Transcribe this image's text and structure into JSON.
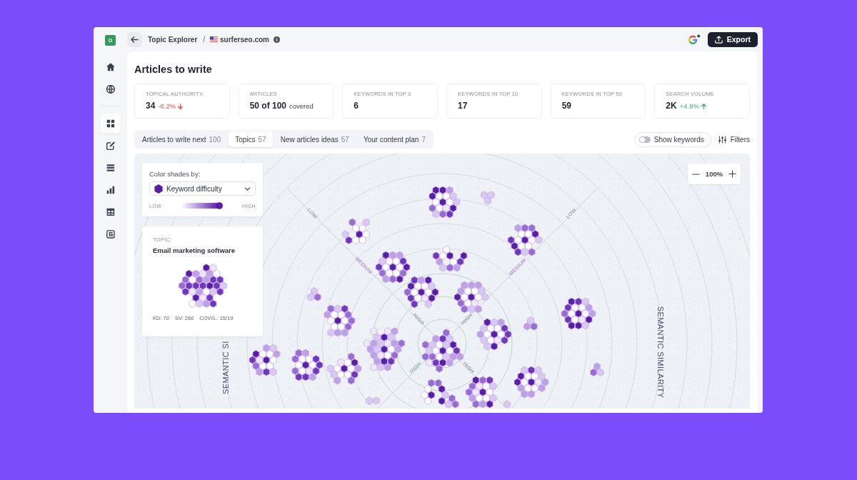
{
  "sidebar": {
    "logo": "O",
    "items": [
      {
        "selected": false
      },
      {
        "selected": false
      },
      {
        "selected": true
      },
      {
        "selected": false
      },
      {
        "selected": false
      },
      {
        "selected": false
      },
      {
        "selected": false
      },
      {
        "selected": false
      }
    ]
  },
  "breadcrumb": {
    "items": [
      "Topic Explorer",
      "surferseo.com"
    ],
    "separator": "/"
  },
  "export_button": {
    "label": "Export"
  },
  "title": "Articles to write",
  "stats": [
    {
      "kind": "down",
      "label": "TOPICAL AUTHORITY",
      "value": "34",
      "change": "-6.2%",
      "color": "#e5534b"
    },
    {
      "kind": "note",
      "label": "ARTICLES",
      "value": "50 of 100",
      "note": "covered"
    },
    {
      "kind": "plain",
      "label": "KEYWORDS IN TOP 3",
      "value": "6"
    },
    {
      "kind": "plain",
      "label": "KEYWORDS IN TOP 10",
      "value": "17"
    },
    {
      "kind": "plain",
      "label": "KEYWORDS IN TOP 50",
      "value": "59"
    },
    {
      "kind": "up",
      "label": "SEARCH VOLUME",
      "value": "2K",
      "change": "+4.9%",
      "color": "#46a878"
    }
  ],
  "tabs": [
    {
      "label": "Articles to write next",
      "count": "100",
      "selected": false
    },
    {
      "label": "Topics",
      "count": "57",
      "selected": true
    },
    {
      "label": "New articles ideas",
      "count": "57",
      "selected": false
    },
    {
      "label": "Your content plan",
      "count": "7",
      "selected": false
    }
  ],
  "keyword_toggle": {
    "label": "Show keywords",
    "on": false
  },
  "filters_button": {
    "label": "Filters"
  },
  "map": {
    "shade_panel": {
      "label": "Color shades by:",
      "select_value": "Keyword difficulty",
      "scale_low": "LOW",
      "scale_high": "HIGH"
    },
    "topic_card": {
      "label": "TOPIC:",
      "title": "Email marketing software",
      "metrics": [
        "KD: 70",
        "SV: 260",
        "COVG.: 15/19"
      ]
    },
    "zoom": "100%",
    "ring_labels": [
      {
        "text": "LOW",
        "kind": "low"
      },
      {
        "text": "LOW",
        "kind": "low"
      },
      {
        "text": "MEDIUM",
        "kind": "medium"
      },
      {
        "text": "MEDIUM",
        "kind": "medium"
      },
      {
        "text": "HIGH",
        "kind": "high"
      },
      {
        "text": "HIGH",
        "kind": "high"
      },
      {
        "text": "HIGH",
        "kind": "high"
      },
      {
        "text": "HIGH",
        "kind": "high"
      }
    ],
    "axis_labels": [
      "SEMANTIC SI",
      "SEMANTIC SIMILARITY"
    ]
  }
}
